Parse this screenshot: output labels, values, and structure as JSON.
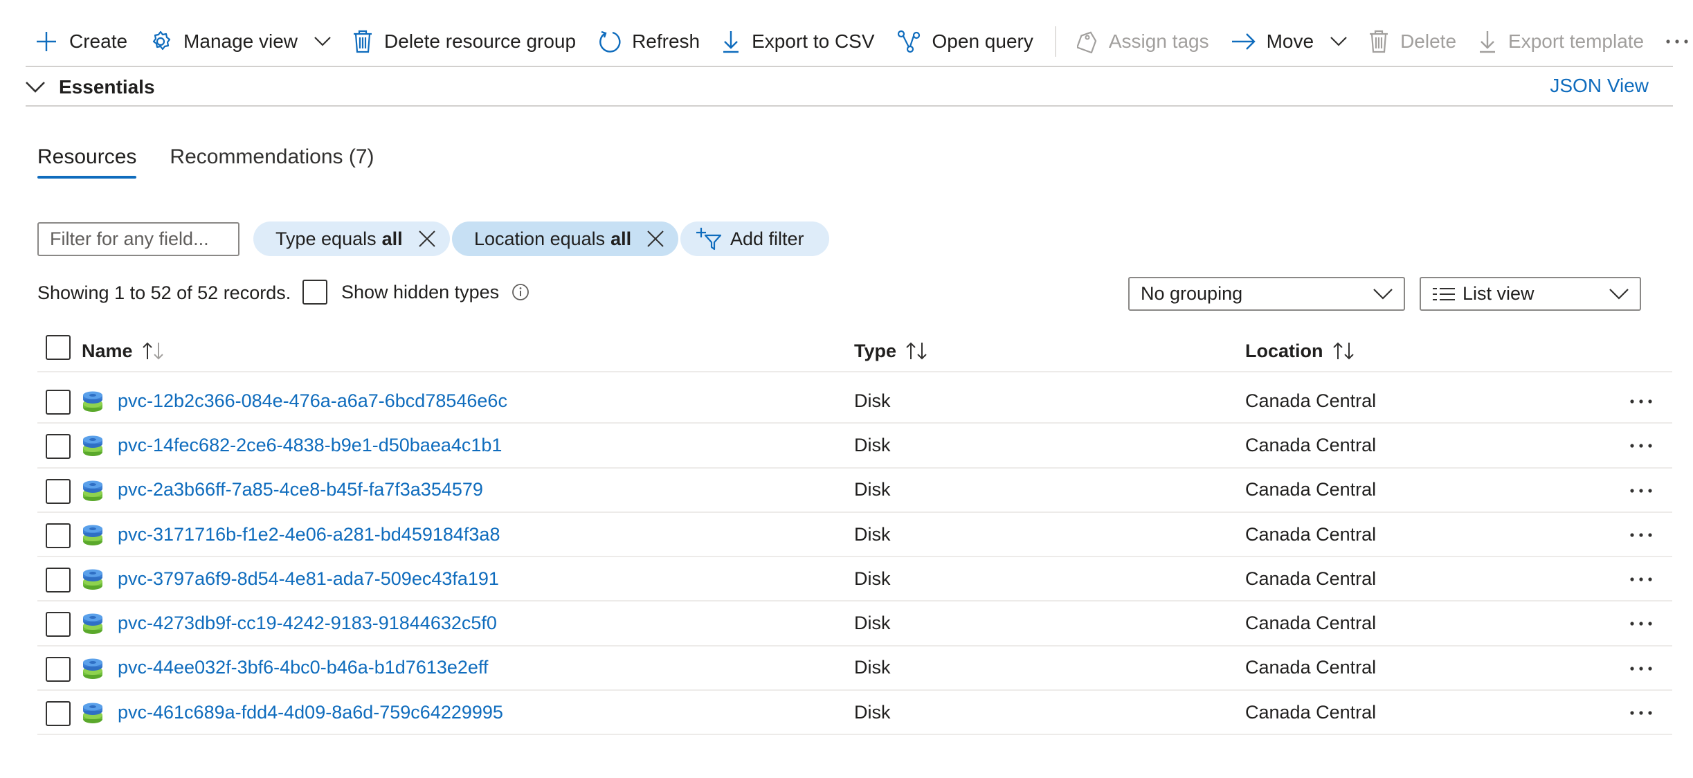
{
  "toolbar": {
    "create": "Create",
    "manage_view": "Manage view",
    "delete_rg": "Delete resource group",
    "refresh": "Refresh",
    "export_csv": "Export to CSV",
    "open_query": "Open query",
    "assign_tags": "Assign tags",
    "move": "Move",
    "delete": "Delete",
    "export_template": "Export template"
  },
  "essentials": {
    "label": "Essentials",
    "json_view": "JSON View"
  },
  "tabs": [
    {
      "label": "Resources",
      "active": true
    },
    {
      "label": "Recommendations (7)",
      "active": false
    }
  ],
  "filters": {
    "placeholder": "Filter for any field...",
    "type_filter": {
      "prefix": "Type equals",
      "value": "all"
    },
    "location_filter": {
      "prefix": "Location equals",
      "value": "all"
    },
    "add_filter": "Add filter"
  },
  "records_text": "Showing 1 to 52 of 52 records.",
  "show_hidden_types": "Show hidden types",
  "grouping": "No grouping",
  "view_mode": "List view",
  "table": {
    "headers": {
      "name": "Name",
      "type": "Type",
      "location": "Location"
    },
    "rows": [
      {
        "name": "pvc-12b2c366-084e-476a-a6a7-6bcd78546e6c",
        "type": "Disk",
        "location": "Canada Central"
      },
      {
        "name": "pvc-14fec682-2ce6-4838-b9e1-d50baea4c1b1",
        "type": "Disk",
        "location": "Canada Central"
      },
      {
        "name": "pvc-2a3b66ff-7a85-4ce8-b45f-fa7f3a354579",
        "type": "Disk",
        "location": "Canada Central"
      },
      {
        "name": "pvc-3171716b-f1e2-4e06-a281-bd459184f3a8",
        "type": "Disk",
        "location": "Canada Central"
      },
      {
        "name": "pvc-3797a6f9-8d54-4e81-ada7-509ec43fa191",
        "type": "Disk",
        "location": "Canada Central"
      },
      {
        "name": "pvc-4273db9f-cc19-4242-9183-91844632c5f0",
        "type": "Disk",
        "location": "Canada Central"
      },
      {
        "name": "pvc-44ee032f-3bf6-4bc0-b46a-b1d7613e2eff",
        "type": "Disk",
        "location": "Canada Central"
      },
      {
        "name": "pvc-461c689a-fdd4-4d09-8a6d-759c64229995",
        "type": "Disk",
        "location": "Canada Central"
      }
    ]
  },
  "colors": {
    "accent": "#0f6cbd",
    "pill": "#deecf9",
    "pill_active": "#c7e0f4",
    "disk_blue": "#3b7fd6",
    "disk_green": "#6fbf3a"
  }
}
